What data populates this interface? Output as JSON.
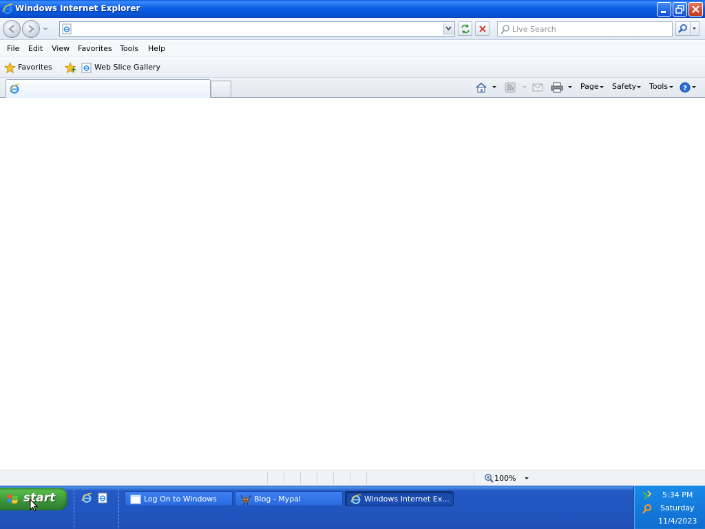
{
  "window": {
    "title": "Windows Internet Explorer",
    "controls": {
      "minimize": "minimize",
      "restore": "restore",
      "close": "close"
    }
  },
  "address_bar": {
    "url_value": "",
    "icons": {
      "back": "back-arrow-icon",
      "forward": "forward-arrow-icon",
      "refresh": "refresh-icon",
      "stop": "stop-icon"
    }
  },
  "search": {
    "placeholder": "Live Search",
    "value": ""
  },
  "menu": {
    "items": [
      "File",
      "Edit",
      "View",
      "Favorites",
      "Tools",
      "Help"
    ]
  },
  "favorites_bar": {
    "favorites_label": "Favorites",
    "web_slice_label": "Web Slice Gallery"
  },
  "tabs": {
    "active_title": ""
  },
  "command_bar": {
    "page_label": "Page",
    "safety_label": "Safety",
    "tools_label": "Tools"
  },
  "status_bar": {
    "zoom": "100%"
  },
  "taskbar": {
    "start_label": "start",
    "buttons": [
      {
        "label": "Log On to Windows",
        "active": false
      },
      {
        "label": "Blog - Mypal",
        "active": false
      },
      {
        "label": "Windows Internet Ex...",
        "active": true
      }
    ],
    "clock": {
      "time": "5:34 PM",
      "day": "Saturday",
      "date": "11/4/2023"
    }
  },
  "colors": {
    "titlebar_blue": "#0b5fe6",
    "taskbar_blue": "#2157c1",
    "start_green": "#3a923a",
    "tray_blue": "#0f6cd0",
    "ie_blue": "#1f6fd1"
  }
}
